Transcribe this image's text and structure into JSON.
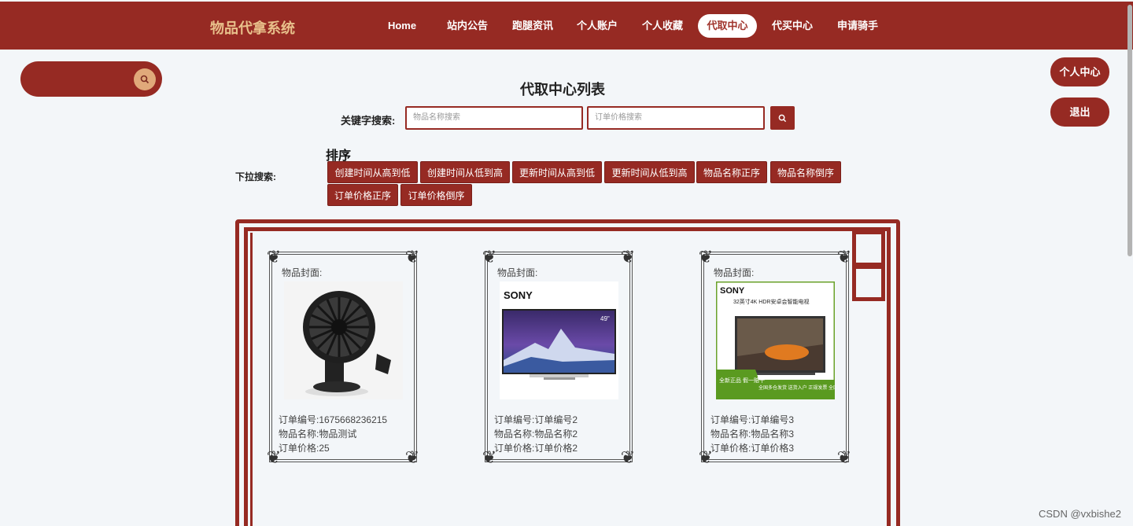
{
  "header": {
    "brand": "物品代拿系统",
    "nav": [
      "Home",
      "站内公告",
      "跑腿资讯",
      "个人账户",
      "个人收藏",
      "代取中心",
      "代买中心",
      "申请骑手"
    ],
    "active_nav": "代取中心"
  },
  "side": {
    "profile_label": "个人中心",
    "logout_label": "退出"
  },
  "main": {
    "title": "代取中心列表",
    "keyword_label": "关键字搜索:",
    "name_placeholder": "物品名称搜索",
    "price_placeholder": "订单价格搜索",
    "sort_title": "排序",
    "dropdown_label": "下拉搜索:",
    "sort_buttons": [
      "创建时间从高到低",
      "创建时间从低到高",
      "更新时间从高到低",
      "更新时间从低到高",
      "物品名称正序",
      "物品名称倒序",
      "订单价格正序",
      "订单价格倒序"
    ]
  },
  "cards": [
    {
      "cover_label": "物品封面:",
      "order_no": "订单编号:1675668236215",
      "name": "物品名称:物品测试",
      "price": "订单价格:25",
      "image": "desk-fan"
    },
    {
      "cover_label": "物品封面:",
      "order_no": "订单编号:订单编号2",
      "name": "物品名称:物品名称2",
      "price": "订单价格:订单价格2",
      "image": "sony-tv",
      "img_brand": "SONY",
      "img_size": "49\""
    },
    {
      "cover_label": "物品封面:",
      "order_no": "订单编号:订单编号3",
      "name": "物品名称:物品名称3",
      "price": "订单价格:订单价格3",
      "image": "sony-tv-ad",
      "img_brand": "SONY",
      "img_headline": "32英寸4K HDR安卓会智能电视",
      "img_badge": "全新正品 假一赔十",
      "img_footer": "全国多仓发货 送货入户 正规发票 全国联保"
    }
  ],
  "watermark": "CSDN @vxbishe2",
  "colors": {
    "primary": "#962a23",
    "brand_text": "#e8c08b",
    "page_bg": "#f3f6f9"
  }
}
